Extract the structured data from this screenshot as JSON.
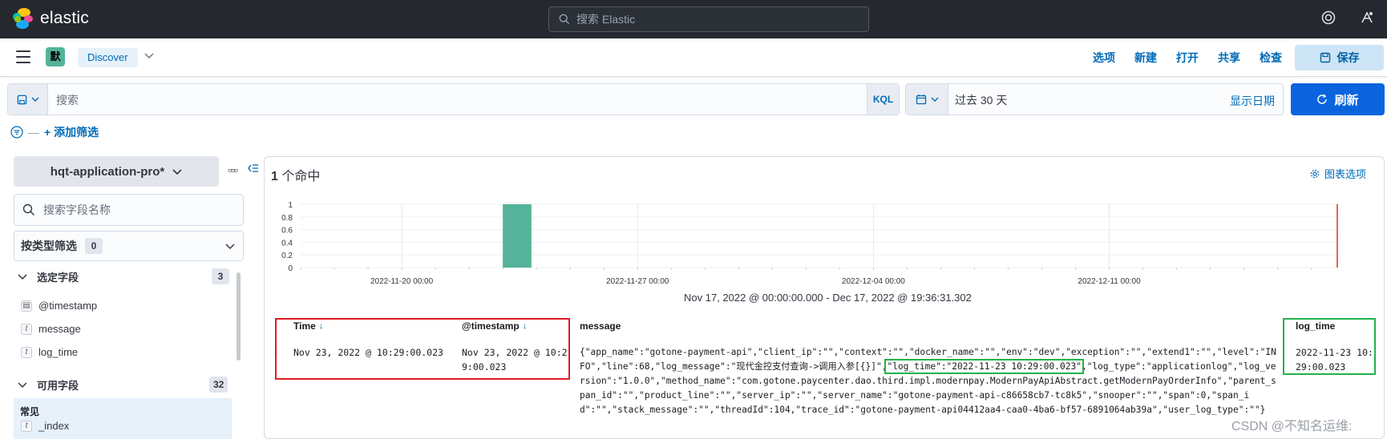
{
  "header": {
    "brand": "elastic",
    "search_placeholder": "搜索 Elastic",
    "icons": [
      "help-icon",
      "newsfeed-icon"
    ]
  },
  "appbar": {
    "space_initial": "默",
    "breadcrumb": "Discover",
    "nav": [
      "选项",
      "新建",
      "打开",
      "共享",
      "检查"
    ],
    "save_label": "保存"
  },
  "query": {
    "placeholder": "搜索",
    "language": "KQL",
    "time_range": "过去 30 天",
    "show_dates": "显示日期",
    "refresh_label": "刷新",
    "add_filter": "+ 添加筛选"
  },
  "sidebar": {
    "index_pattern": "hqt-application-pro*",
    "field_search_placeholder": "搜索字段名称",
    "type_filter_label": "按类型筛选",
    "type_filter_count": "0",
    "selected_section": "选定字段",
    "selected_count": "3",
    "selected_fields": [
      {
        "name": "@timestamp",
        "type": "date"
      },
      {
        "name": "message",
        "type": "t"
      },
      {
        "name": "log_time",
        "type": "t"
      }
    ],
    "available_section": "可用字段",
    "available_count": "32",
    "common_label": "常见",
    "common_fields": [
      {
        "name": "_index",
        "type": "t"
      }
    ]
  },
  "main": {
    "hits_count": "1",
    "hits_label": "个命中",
    "chart_options": "图表选项",
    "range_text": "Nov 17, 2022 @ 00:00:00.000 - Dec 17, 2022 @ 19:36:31.302",
    "columns": [
      "Time",
      "@timestamp",
      "message",
      "log_time"
    ],
    "row": {
      "time": "Nov 23, 2022 @ 10:29:00.023",
      "timestamp": "Nov 23, 2022 @ 10:29:00.023",
      "message_before": "{\"app_name\":\"gotone-payment-api\",\"client_ip\":\"\",\"context\":\"\",\"docker_name\":\"\",\"env\":\"dev\",\"exception\":\"\",\"extend1\":\"\",\"level\":\"INFO\",\"line\":68,\"log_message\":\"现代金控支付查询->调用入参[{}]\",",
      "message_highlight": "\"log_time\":\"2022-11-23 10:29:00.023\"",
      "message_after": ",\"log_type\":\"applicationlog\",\"log_version\":\"1.0.0\",\"method_name\":\"com.gotone.paycenter.dao.third.impl.modernpay.ModernPayApiAbstract.getModernPayOrderInfo\",\"parent_span_id\":\"\",\"product_line\":\"\",\"server_ip\":\"\",\"server_name\":\"gotone-payment-api-c86658cb7-tc8k5\",\"snooper\":\"\",\"span\":0,\"span_id\":\"\",\"stack_message\":\"\",\"threadId\":104,\"trace_id\":\"gotone-payment-api04412aa4-caa0-4ba6-bf57-6891064ab39a\",\"user_log_type\":\"\"}",
      "log_time": "2022-11-23 10:29:00.023"
    }
  },
  "chart_data": {
    "type": "bar",
    "x_ticks": [
      "2022-11-20 00:00",
      "2022-11-27 00:00",
      "2022-12-04 00:00",
      "2022-12-11 00:00"
    ],
    "y_ticks": [
      "1",
      "0.8",
      "0.6",
      "0.4",
      "0.2",
      "0"
    ],
    "ylim": [
      0,
      1
    ],
    "xlim": [
      "2022-11-17",
      "2022-12-17"
    ],
    "bars": [
      {
        "x": "2022-11-23",
        "value": 1
      }
    ],
    "now_marker": "2022-12-17",
    "bar_color": "#54b399",
    "marker_color": "#e7664c"
  },
  "watermark": "CSDN @不知名运维:"
}
